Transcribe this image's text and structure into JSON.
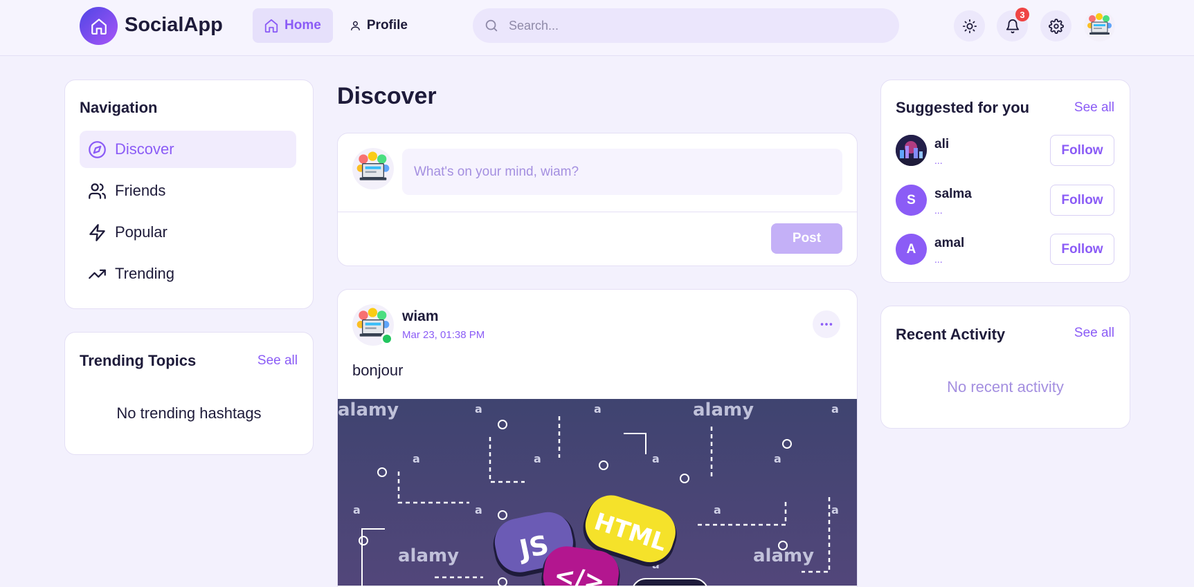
{
  "app": {
    "name": "SocialApp",
    "icon": "home-icon",
    "accent": "#8b5cf6",
    "brand_gradient": [
      "#4f46e5",
      "#a855f7"
    ]
  },
  "header": {
    "nav": [
      {
        "label": "Home",
        "icon": "home-icon",
        "active": true
      },
      {
        "label": "Profile",
        "icon": "user-icon",
        "active": false
      }
    ],
    "search": {
      "placeholder": "Search...",
      "value": ""
    },
    "notifications": {
      "count": "3",
      "icon": "bell-icon"
    },
    "theme_icon": "sun-icon",
    "settings_icon": "gear-icon"
  },
  "sidebar": {
    "navigation": {
      "title": "Navigation",
      "items": [
        {
          "label": "Discover",
          "icon": "compass-icon",
          "active": true
        },
        {
          "label": "Friends",
          "icon": "users-icon",
          "active": false
        },
        {
          "label": "Popular",
          "icon": "lightning-icon",
          "active": false
        },
        {
          "label": "Trending",
          "icon": "trending-up-icon",
          "active": false
        }
      ]
    },
    "trending": {
      "title": "Trending Topics",
      "see_all": "See all",
      "empty": "No trending hashtags"
    }
  },
  "main": {
    "title": "Discover",
    "composer": {
      "placeholder": "What's on your mind, wiam?",
      "post_label": "Post"
    },
    "posts": [
      {
        "author": "wiam",
        "time": "Mar 23, 01:38 PM",
        "online": true,
        "text": "bonjour",
        "image": {
          "watermark": "alamy",
          "tags": [
            "JS",
            "HTML",
            "</>"
          ]
        }
      }
    ]
  },
  "right": {
    "suggested": {
      "title": "Suggested for you",
      "see_all": "See all",
      "users": [
        {
          "name": "ali",
          "sub": "...",
          "initial": "",
          "color": "#2a2550"
        },
        {
          "name": "salma",
          "sub": "...",
          "initial": "S",
          "color": "#8b5cf6"
        },
        {
          "name": "amal",
          "sub": "...",
          "initial": "A",
          "color": "#8b5cf6"
        }
      ],
      "follow_label": "Follow"
    },
    "activity": {
      "title": "Recent Activity",
      "see_all": "See all",
      "empty": "No recent activity"
    }
  }
}
